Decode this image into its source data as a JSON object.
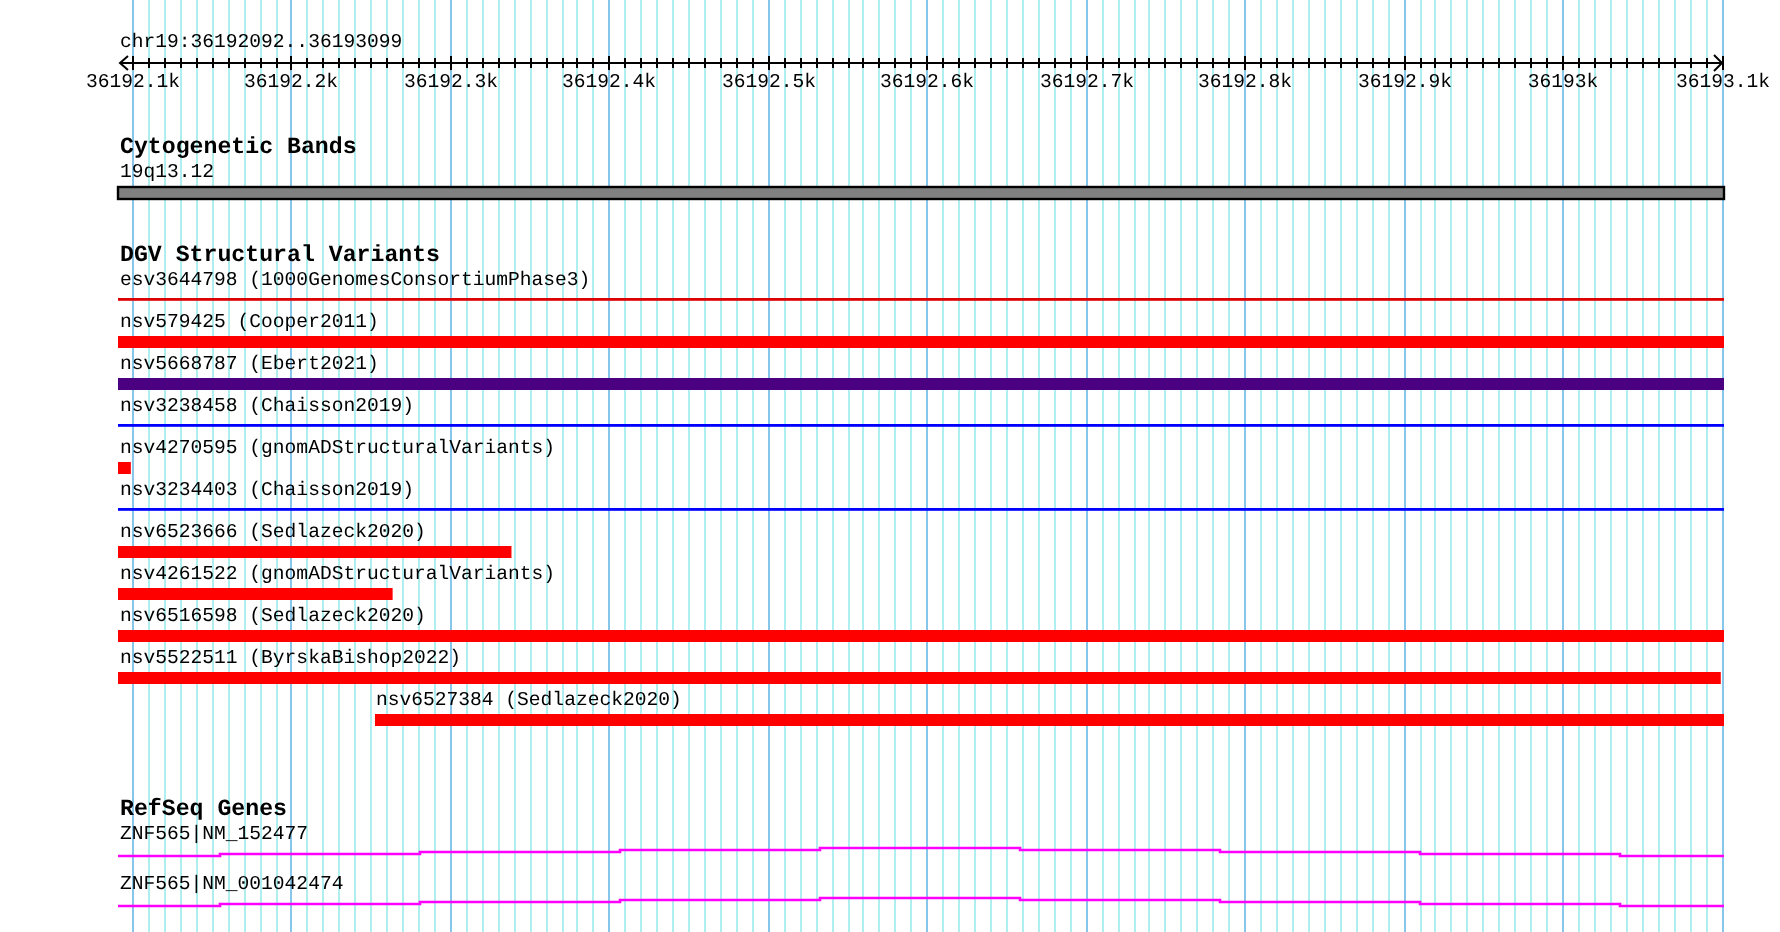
{
  "location": "chr19:36192092..36193099",
  "ruler": {
    "ticks": [
      "36192.1k",
      "36192.2k",
      "36192.3k",
      "36192.4k",
      "36192.5k",
      "36192.6k",
      "36192.7k",
      "36192.8k",
      "36192.9k",
      "36193k",
      "36193.1k"
    ]
  },
  "tracks": [
    {
      "kind": "cytoband",
      "title": "Cytogenetic Bands",
      "features": [
        {
          "label": "19q13.12",
          "color": "#808080"
        }
      ]
    },
    {
      "kind": "variants",
      "title": "DGV Structural Variants",
      "features": [
        {
          "label": "esv3644798 (1000GenomesConsortiumPhase3)",
          "kind": "line",
          "level": 1,
          "color": "#dd0000"
        },
        {
          "label": "nsv579425 (Cooper2011)",
          "kind": "bar",
          "level": 1,
          "color": "#ff0000"
        },
        {
          "label": "nsv5668787 (Ebert2021)",
          "kind": "bar",
          "level": 1,
          "color": "#4b0082"
        },
        {
          "label": "nsv3238458 (Chaisson2019)",
          "kind": "line",
          "level": 1,
          "color": "#0000ff"
        },
        {
          "label": "nsv4270595 (gnomADStructuralVariants)",
          "kind": "bar",
          "level": 0.008,
          "color": "#ff0000"
        },
        {
          "label": "nsv3234403 (Chaisson2019)",
          "kind": "line",
          "level": 1,
          "color": "#0000ff"
        },
        {
          "label": "nsv6523666 (Sedlazeck2020)",
          "kind": "bar",
          "level": 0.245,
          "color": "#ff0000"
        },
        {
          "label": "nsv4261522 (gnomADStructuralVariants)",
          "kind": "bar",
          "level": 0.171,
          "color": "#ff0000"
        },
        {
          "label": "nsv6516598 (Sedlazeck2020)",
          "kind": "bar",
          "level": 1,
          "color": "#ff0000"
        },
        {
          "label": "nsv5522511 (ByrskaBishop2022)",
          "kind": "bar",
          "level": 0.998,
          "color": "#ff0000"
        },
        {
          "label": "nsv6527384 (Sedlazeck2020)",
          "kind": "end-bar",
          "level": 0.84,
          "color": "#ff0000"
        }
      ]
    },
    {
      "kind": "genes",
      "title": "RefSeq Genes",
      "features": [
        {
          "label": "ZNF565|NM_152477",
          "color": "#ff00ff"
        },
        {
          "label": "ZNF565|NM_001042474",
          "color": "#ff00ff"
        }
      ]
    }
  ]
}
